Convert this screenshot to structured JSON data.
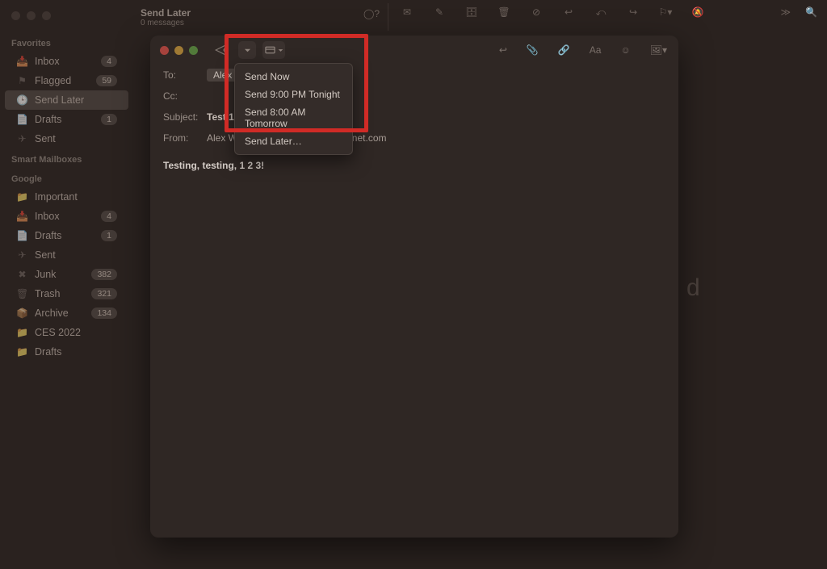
{
  "header": {
    "title": "Send Later",
    "subtitle": "0 messages"
  },
  "sidebar": {
    "favorites_header": "Favorites",
    "smart_header": "Smart Mailboxes",
    "google_header": "Google",
    "favorites": [
      {
        "label": "Inbox",
        "badge": "4",
        "icon": "📥"
      },
      {
        "label": "Flagged",
        "badge": "59",
        "icon": "⚑"
      },
      {
        "label": "Send Later",
        "badge": "",
        "icon": "🕒"
      },
      {
        "label": "Drafts",
        "badge": "1",
        "icon": "📄"
      },
      {
        "label": "Sent",
        "badge": "",
        "icon": "✈"
      }
    ],
    "google": [
      {
        "label": "Important",
        "badge": "",
        "icon": "📁"
      },
      {
        "label": "Inbox",
        "badge": "4",
        "icon": "📥"
      },
      {
        "label": "Drafts",
        "badge": "1",
        "icon": "📄"
      },
      {
        "label": "Sent",
        "badge": "",
        "icon": "✈"
      },
      {
        "label": "Junk",
        "badge": "382",
        "icon": "✖"
      },
      {
        "label": "Trash",
        "badge": "321",
        "icon": "🗑"
      },
      {
        "label": "Archive",
        "badge": "134",
        "icon": "📦"
      },
      {
        "label": "CES 2022",
        "badge": "",
        "icon": "📁"
      },
      {
        "label": "Drafts",
        "badge": "",
        "icon": "📁"
      }
    ]
  },
  "compose": {
    "to_label": "To:",
    "to_value": "Alex Wawro",
    "cc_label": "Cc:",
    "subject_label": "Subject:",
    "subject_value": "Test 1 2 3",
    "from_label": "From:",
    "from_value": "Alex Wawro – alex.wawro@futurenet.com",
    "body": "Testing, testing, 1 2  3!"
  },
  "dropdown": {
    "items": [
      "Send Now",
      "Send 9:00 PM Tonight",
      "Send 8:00 AM Tomorrow",
      "Send Later…"
    ]
  },
  "bg_text": "d"
}
